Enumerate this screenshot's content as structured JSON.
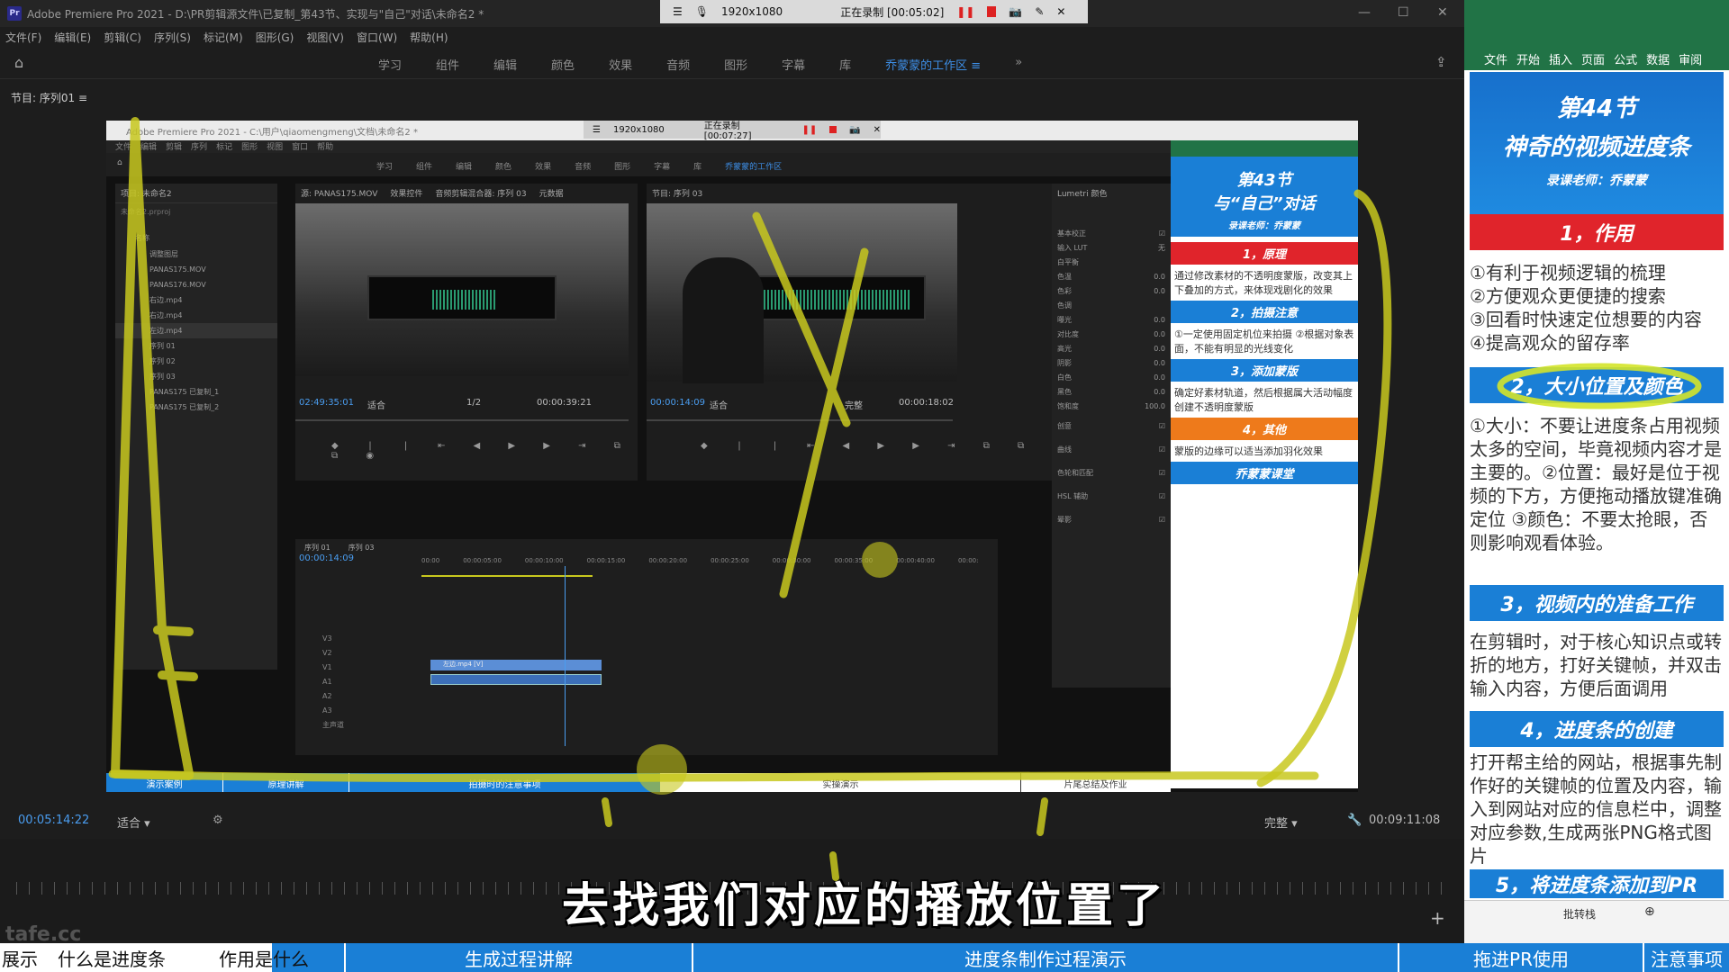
{
  "app": {
    "title": "Adobe Premiere Pro 2021 - D:\\PR剪辑源文件\\已复制_第43节、实现与\"自己\"对话\\未命名2 *",
    "logo": "Pr",
    "menu": [
      "文件(F)",
      "编辑(E)",
      "剪辑(C)",
      "序列(S)",
      "标记(M)",
      "图形(G)",
      "视图(V)",
      "窗口(W)",
      "帮助(H)"
    ],
    "workspaces": [
      "学习",
      "组件",
      "编辑",
      "颜色",
      "效果",
      "音频",
      "图形",
      "字幕",
      "库"
    ],
    "active_workspace": "乔蒙蒙的工作区",
    "sequence_title": "节目: 序列01"
  },
  "recorder": {
    "resolution": "1920x1080",
    "status": "正在录制 [00:05:02]"
  },
  "inner": {
    "title": "Adobe Premiere Pro 2021 - C:\\用户\\qiaomengmeng\\文档\\未命名2 *",
    "recorder": {
      "resolution": "1920x1080",
      "status": "正在录制 [00:07:27]"
    },
    "menu": [
      "文件",
      "编辑",
      "剪辑",
      "序列",
      "标记",
      "图形",
      "视图",
      "窗口",
      "帮助"
    ],
    "workspaces": [
      "学习",
      "组件",
      "编辑",
      "颜色",
      "效果",
      "音频",
      "图形",
      "字幕",
      "库"
    ],
    "active_workspace": "乔蒙蒙的工作区",
    "project": {
      "header": "项目: 未命名2",
      "file": "未命名2.prproj",
      "column": "名称",
      "items": [
        "调整图层",
        "PANAS175.MOV",
        "PANAS176.MOV",
        "右边.mp4",
        "右边.mp4",
        "左边.mp4",
        "序列 01",
        "序列 02",
        "序列 03",
        "PANAS175 已复制_1",
        "PANAS175 已复制_2"
      ]
    },
    "source": {
      "tabs": [
        "源: PANAS175.MOV",
        "效果控件",
        "音频剪辑混合器: 序列 03",
        "元数据"
      ],
      "tc_left": "02:49:35:01",
      "fit": "适合",
      "fraction": "1/2",
      "tc_right": "00:00:39:21"
    },
    "program": {
      "tab": "节目: 序列 03",
      "tc_left": "00:00:14:09",
      "fit": "适合",
      "quality": "完整",
      "tc_right": "00:00:18:02"
    },
    "timeline": {
      "tabs": [
        "序列 01",
        "序列 03"
      ],
      "tc": "00:00:14:09",
      "ruler": [
        "00:00",
        "00:00:05:00",
        "00:00:10:00",
        "00:00:15:00",
        "00:00:20:00",
        "00:00:25:00",
        "00:00:30:00",
        "00:00:35:00",
        "00:00:40:00",
        "00:00:"
      ],
      "tracks": [
        "V3",
        "V2",
        "V1",
        "A1",
        "A2",
        "A3",
        "主声道"
      ],
      "clip_label": "左边.mp4 [V]"
    },
    "lumetri": {
      "header": "Lumetri 颜色",
      "sections": [
        "基本校正",
        "输入 LUT",
        "白平衡",
        "色温",
        "色彩",
        "色调",
        "曝光",
        "对比度",
        "高光",
        "阴影",
        "白色",
        "黑色",
        "饱和度",
        "创意",
        "曲线",
        "色轮和匹配",
        "HSL 辅助",
        "晕影"
      ],
      "lut_value": "无",
      "value": "0.0",
      "saturation": "100.0"
    },
    "notes": {
      "title_line1": "第43节",
      "title_line2": "与“自己”对话",
      "teacher": "录课老师：乔蒙蒙",
      "h1": "1，原理",
      "t1": "通过修改素材的不透明度蒙版，改变其上下叠加的方式，来体现戏剧化的效果",
      "h2": "2，拍摄注意",
      "t2": "①一定使用固定机位来拍摄 ②根据对象表面，不能有明显的光线变化",
      "h3": "3，添加蒙版",
      "t3": "确定好素材轨道，然后根据属大活动幅度创建不透明度蒙版",
      "h4": "4，其他",
      "t4": "蒙版的边缘可以适当添加羽化效果",
      "footer": "乔蒙蒙课堂"
    },
    "chapters": [
      "演示案例",
      "原理讲解",
      "拍摄时的注意事项",
      "实操演示",
      "片尾总结及作业"
    ]
  },
  "player": {
    "tc_left": "00:05:14:22",
    "fit": "适合",
    "quality": "完整",
    "tc_right": "00:09:11:08"
  },
  "subtitle": "去找我们对应的播放位置了",
  "watermark": "tafe.cc",
  "bottom_chapters": [
    "展示",
    "什么是进度条",
    "作用是什么",
    "生成过程讲解",
    "进度条制作过程演示",
    "拖进PR使用",
    "注意事项"
  ],
  "side": {
    "tabs": [
      "文件",
      "开始",
      "插入",
      "页面",
      "公式",
      "数据",
      "审阅"
    ],
    "title1": "第44节",
    "title2": "神奇的视频进度条",
    "teacher": "录课老师：乔蒙蒙",
    "h1": "1，作用",
    "items1": [
      "①有利于视频逻辑的梳理",
      "②方便观众更便捷的搜索",
      "③回看时快速定位想要的内容",
      "④提高观众的留存率"
    ],
    "h2": "2，大小位置及颜色",
    "t2": "①大小：不要让进度条占用视频太多的空间，毕竟视频内容才是主要的。②位置：最好是位于视频的下方，方便拖动播放键准确定位 ③颜色：不要太抢眼，否则影响观看体验。",
    "h3": "3，视频内的准备工作",
    "t3": "在剪辑时，对于核心知识点或转折的地方，打好关键帧，并双击输入内容，方便后面调用",
    "h4": "4，进度条的创建",
    "t4": "打开帮主给的网站，根据事先制作好的关键帧的位置及内容，输入到网站对应的信息栏中，调整对应参数,生成两张PNG格式图片",
    "h5": "5，将进度条添加到PR",
    "footer_label": "批转栈"
  },
  "colors": {
    "accent_blue": "#1a7fd6",
    "red": "#e0242b",
    "orange": "#ee7a1b",
    "highlight": "#c8c81e",
    "excel_green": "#217346"
  }
}
